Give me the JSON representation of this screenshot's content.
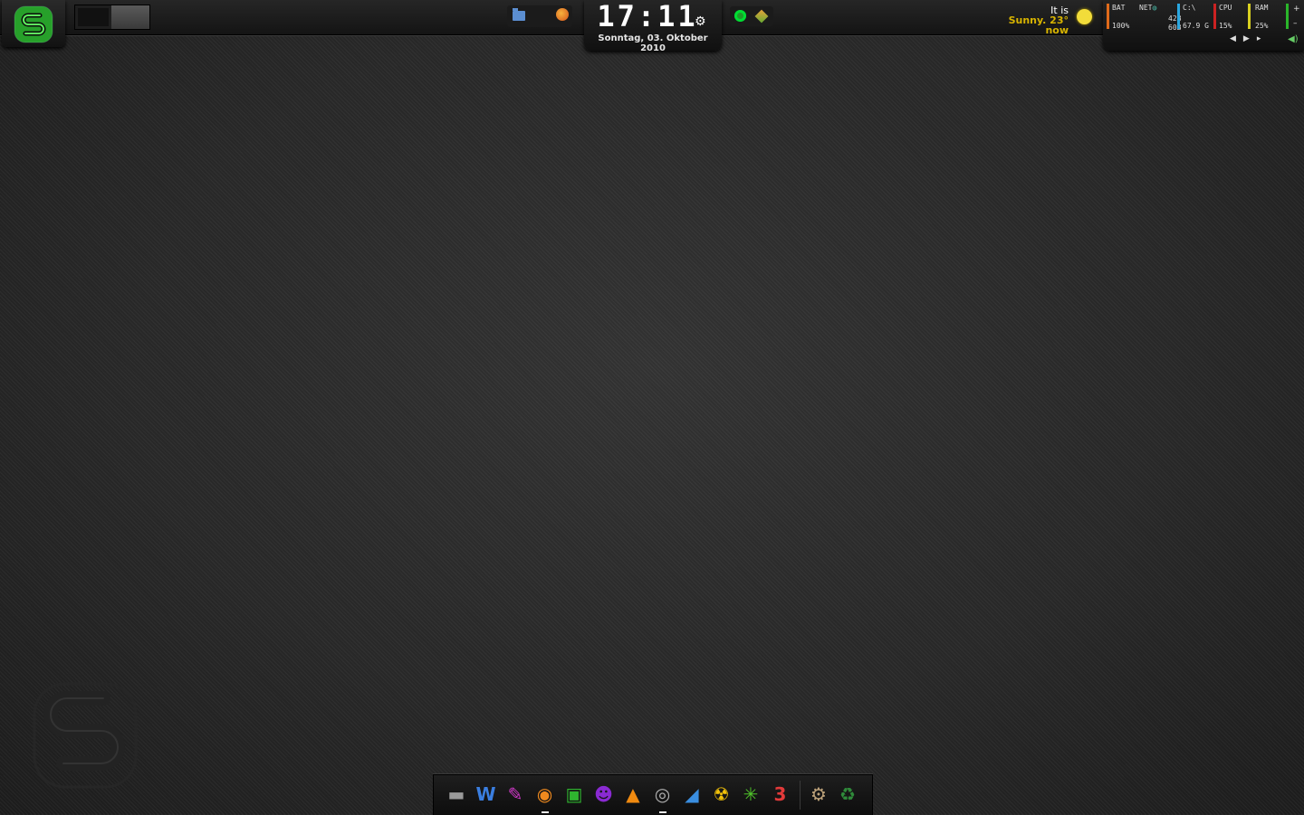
{
  "topbar": {
    "clock": {
      "time": "17:11",
      "date": "Sonntag, 03. Oktober 2010"
    },
    "weather": {
      "line1": "It is",
      "line2": "Sunny. 23° now",
      "icon": "sun-icon"
    },
    "stats": {
      "bat": {
        "label": "BAT",
        "value": "100%",
        "color": "#e06a1a"
      },
      "net": {
        "label": "NET",
        "up": "42B",
        "down": "60B"
      },
      "disk": {
        "label": "C:\\",
        "value": "67.9 G",
        "color": "#2aa7e0"
      },
      "cpu": {
        "label": "CPU",
        "value": "15%",
        "color": "#cc2222"
      },
      "ram": {
        "label": "RAM",
        "value": "25%",
        "color": "#d8d020"
      }
    },
    "volume_plus": "+",
    "volume_minus": "–"
  },
  "dock": {
    "items": [
      {
        "name": "file-manager-icon",
        "glyph": "▬",
        "color": "#9a9a9a"
      },
      {
        "name": "w-app-icon",
        "glyph": "W",
        "color": "#3a7ee0"
      },
      {
        "name": "graphics-app-icon",
        "glyph": "✎",
        "color": "#d23acb"
      },
      {
        "name": "firefox-icon",
        "glyph": "◉",
        "color": "#ef8a1e",
        "running": true
      },
      {
        "name": "photo-app-icon",
        "glyph": "▣",
        "color": "#2fb52f"
      },
      {
        "name": "alien-app-icon",
        "glyph": "☻",
        "color": "#8a2ad2"
      },
      {
        "name": "vlc-icon",
        "glyph": "▲",
        "color": "#f08a10"
      },
      {
        "name": "media-player-icon",
        "glyph": "◎",
        "color": "#b0b0b0",
        "running": true
      },
      {
        "name": "editor-icon",
        "glyph": "◢",
        "color": "#3a8ee0"
      },
      {
        "name": "burn-app-icon",
        "glyph": "☢",
        "color": "#f2c20a"
      },
      {
        "name": "lime-app-icon",
        "glyph": "✳",
        "color": "#4fc22a"
      },
      {
        "name": "calendar-icon",
        "glyph": "3",
        "color": "#e23a3a"
      },
      {
        "name": "settings-icon",
        "glyph": "⚙",
        "color": "#bda27a"
      },
      {
        "name": "trash-icon",
        "glyph": "♻",
        "color": "#2f8a3a"
      }
    ]
  }
}
